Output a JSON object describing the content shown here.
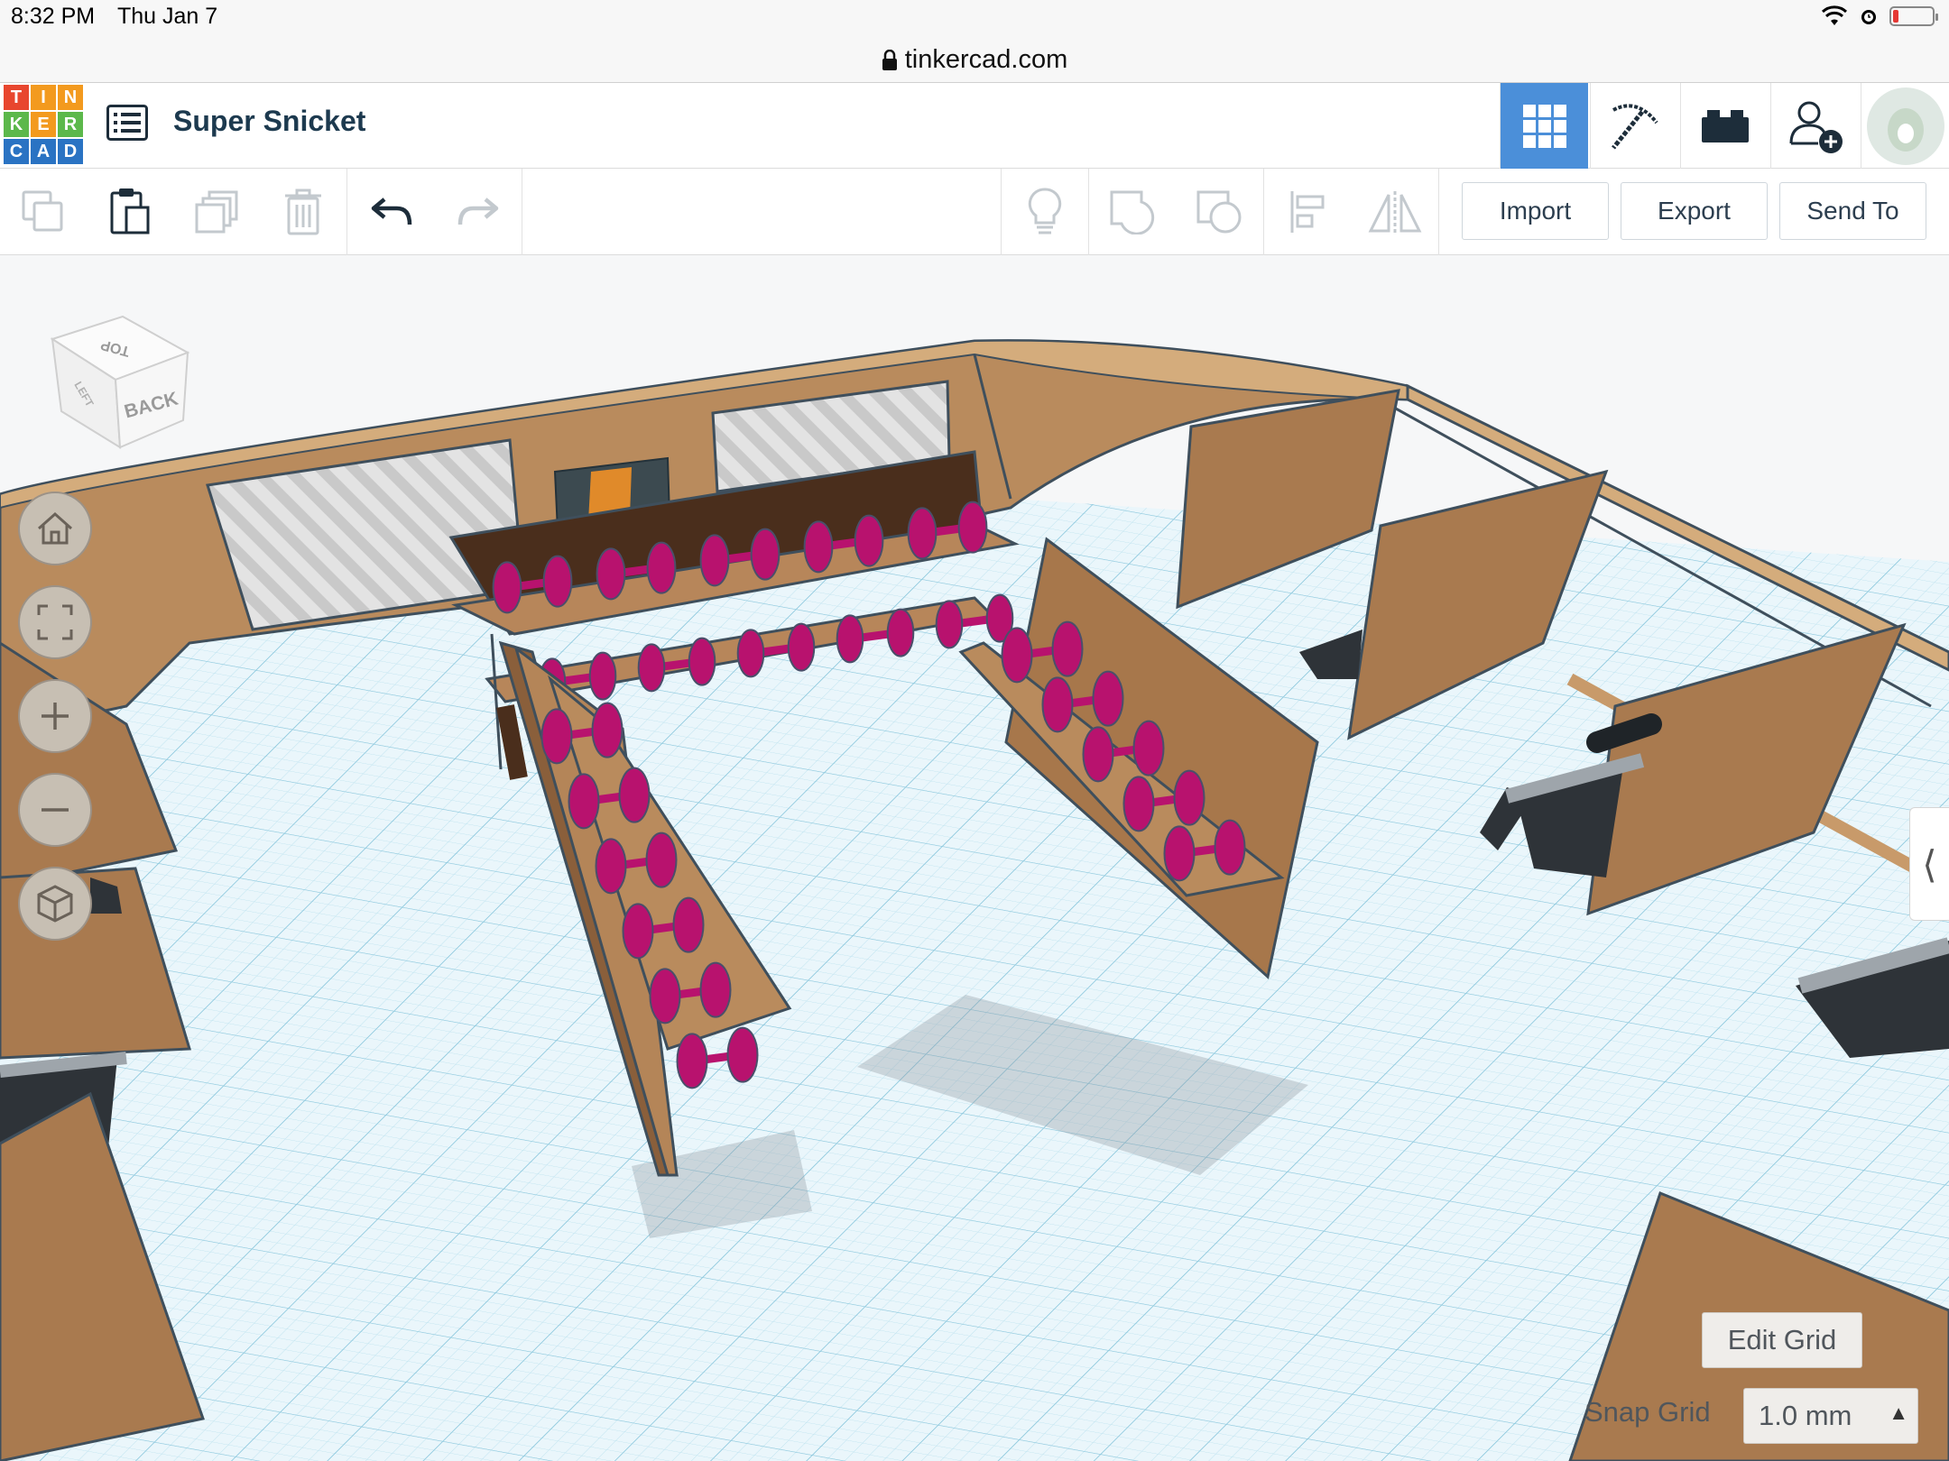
{
  "status_bar": {
    "time": "8:32 PM",
    "date": "Thu Jan 7",
    "icons": [
      "wifi-icon",
      "alarm-icon",
      "battery-low-icon"
    ]
  },
  "browser": {
    "url": "tinkercad.com",
    "lock_icon": "lock-icon"
  },
  "app": {
    "logo_letters": [
      "T",
      "I",
      "N",
      "K",
      "E",
      "R",
      "C",
      "A",
      "D"
    ],
    "logo_colors": [
      "#e8462e",
      "#f39a1e",
      "#f39a1e",
      "#5cb84b",
      "#f39a1e",
      "#5cb84b",
      "#2a73c3",
      "#2a73c3",
      "#2a73c3"
    ],
    "design_title": "Super Snicket",
    "modes": [
      {
        "name": "3d-design",
        "icon": "grid-icon",
        "active": true
      },
      {
        "name": "circuits",
        "icon": "pickaxe-icon",
        "active": false
      },
      {
        "name": "codeblocks",
        "icon": "bricks-icon",
        "active": false
      },
      {
        "name": "invite",
        "icon": "add-user-icon",
        "active": false
      }
    ],
    "accent_color": "#4b8fd9"
  },
  "toolbar": {
    "left_tools": [
      "copy-icon",
      "paste-icon",
      "duplicate-icon",
      "delete-icon",
      "undo-icon",
      "redo-icon"
    ],
    "right_tools": [
      "light-bulb-icon",
      "group-icon",
      "ungroup-icon",
      "align-icon",
      "mirror-icon"
    ],
    "import_label": "Import",
    "export_label": "Export",
    "send_to_label": "Send To"
  },
  "workplane": {
    "viewcube_faces": {
      "top": "TOP",
      "front": "BACK",
      "side": "LEFT"
    },
    "nav_buttons": [
      "home-icon",
      "fit-view-icon",
      "zoom-in-icon",
      "zoom-out-icon",
      "perspective-icon"
    ],
    "edit_grid_label": "Edit Grid",
    "snap_grid_label": "Snap Grid",
    "snap_grid_value": "1.0 mm",
    "dumbbell_color": "#b8126e",
    "wood_color": "#a97a4f"
  }
}
